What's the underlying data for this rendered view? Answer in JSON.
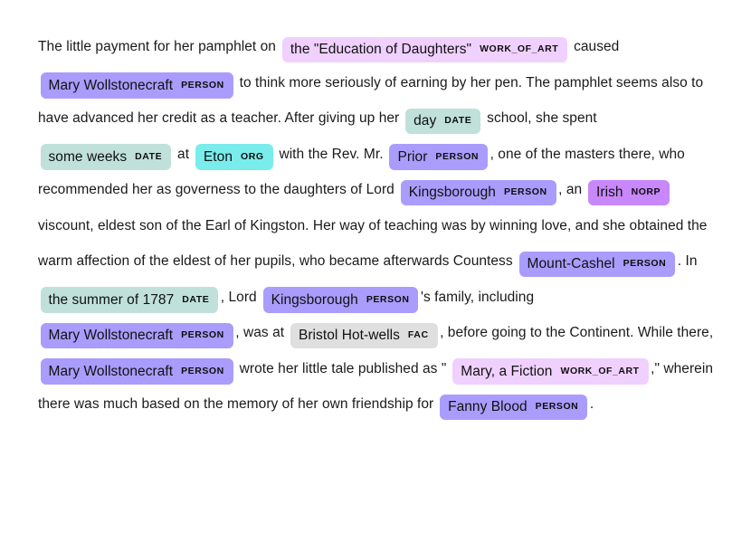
{
  "view": {
    "kind": "displacy-ner-visualization",
    "background_color": "#ffffff",
    "text_color": "#1a1a1a"
  },
  "entity_colors": {
    "PERSON": "#aa9cfc",
    "DATE": "#bfe1d9",
    "ORG": "#7aecec",
    "NORP": "#c887fb",
    "WORK_OF_ART": "#f0d0ff",
    "FAC": "#dfdfdf"
  },
  "tokens": [
    {
      "type": "text",
      "text": "The little payment for her pamphlet on "
    },
    {
      "type": "ent",
      "text": "the \"Education of Daughters\"",
      "label": "WORK_OF_ART"
    },
    {
      "type": "text",
      "text": " caused "
    },
    {
      "type": "ent",
      "text": "Mary Wollstonecraft",
      "label": "PERSON"
    },
    {
      "type": "text",
      "text": " to think more seriously of earning by her pen. The pamphlet seems also to have advanced her credit as a teacher. After giving up her "
    },
    {
      "type": "ent",
      "text": "day",
      "label": "DATE"
    },
    {
      "type": "text",
      "text": " school, she spent "
    },
    {
      "type": "ent",
      "text": "some weeks",
      "label": "DATE"
    },
    {
      "type": "text",
      "text": " at "
    },
    {
      "type": "ent",
      "text": "Eton",
      "label": "ORG"
    },
    {
      "type": "text",
      "text": " with the Rev. Mr. "
    },
    {
      "type": "ent",
      "text": "Prior",
      "label": "PERSON"
    },
    {
      "type": "text",
      "text": ", one of the masters there, who recommended her as governess to the daughters of Lord "
    },
    {
      "type": "ent",
      "text": "Kingsborough",
      "label": "PERSON"
    },
    {
      "type": "text",
      "text": ", an "
    },
    {
      "type": "ent",
      "text": "Irish",
      "label": "NORP"
    },
    {
      "type": "text",
      "text": " viscount, eldest son of the Earl of Kingston. Her way of teaching was by winning love, and she obtained the warm affection of the eldest of her pupils, who became afterwards Countess "
    },
    {
      "type": "ent",
      "text": "Mount-Cashel",
      "label": "PERSON"
    },
    {
      "type": "text",
      "text": ". In "
    },
    {
      "type": "ent",
      "text": "the summer of 1787",
      "label": "DATE"
    },
    {
      "type": "text",
      "text": ", Lord "
    },
    {
      "type": "ent",
      "text": "Kingsborough",
      "label": "PERSON"
    },
    {
      "type": "text",
      "text": "'s family, including "
    },
    {
      "type": "ent",
      "text": "Mary Wollstonecraft",
      "label": "PERSON"
    },
    {
      "type": "text",
      "text": ", was at "
    },
    {
      "type": "ent",
      "text": "Bristol Hot-wells",
      "label": "FAC"
    },
    {
      "type": "text",
      "text": ", before going to the Continent. While there, "
    },
    {
      "type": "ent",
      "text": "Mary Wollstonecraft",
      "label": "PERSON"
    },
    {
      "type": "text",
      "text": " wrote her little tale published as \" "
    },
    {
      "type": "ent",
      "text": "Mary, a Fiction",
      "label": "WORK_OF_ART"
    },
    {
      "type": "text",
      "text": ",\" wherein there was much based on the memory of her own friendship for "
    },
    {
      "type": "ent",
      "text": "Fanny Blood",
      "label": "PERSON"
    },
    {
      "type": "text",
      "text": "."
    }
  ]
}
